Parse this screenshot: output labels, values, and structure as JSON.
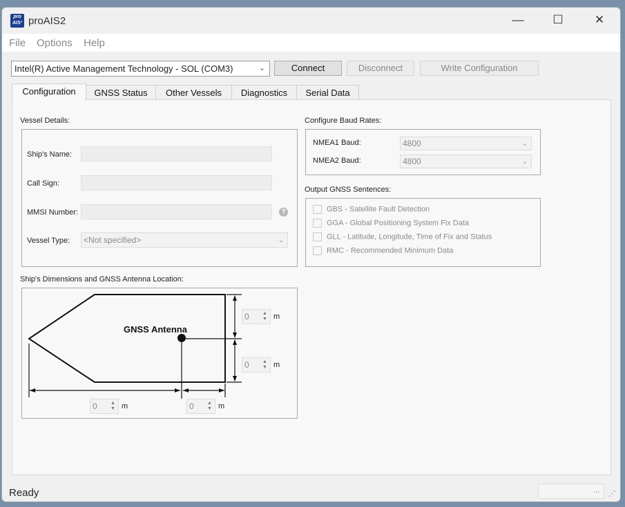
{
  "window": {
    "logo_text": "pro AIS²",
    "title": "proAIS2",
    "minimize": "—",
    "maximize": "☐",
    "close": "✕"
  },
  "menu": [
    "File",
    "Options",
    "Help"
  ],
  "toolbar": {
    "port": "Intel(R) Active Management Technology - SOL (COM3)",
    "connect": "Connect",
    "disconnect": "Disconnect",
    "write": "Write Configuration"
  },
  "tabs": [
    "Configuration",
    "GNSS Status",
    "Other Vessels",
    "Diagnostics",
    "Serial Data"
  ],
  "vessel": {
    "section_title": "Vessel Details:",
    "ship_name_label": "Ship's Name:",
    "ship_name_value": "",
    "call_sign_label": "Call Sign:",
    "call_sign_value": "",
    "mmsi_label": "MMSI Number:",
    "mmsi_value": "",
    "type_label": "Vessel Type:",
    "type_value": "<Not specified>",
    "help_icon": "?"
  },
  "baud": {
    "section_title": "Configure Baud Rates:",
    "nmea1_label": "NMEA1 Baud:",
    "nmea1_value": "4800",
    "nmea2_label": "NMEA2 Baud:",
    "nmea2_value": "4800"
  },
  "gnss": {
    "section_title": "Output GNSS Sentences:",
    "sentences": [
      {
        "label": "GBS - Satellite Fault Detection",
        "checked": false
      },
      {
        "label": "GGA - Global Positioning System Fix Data",
        "checked": false
      },
      {
        "label": "GLL - Latitude, Longitude, Time of Fix and Status",
        "checked": false
      },
      {
        "label": "RMC - Recommended Minimum Data",
        "checked": false
      }
    ]
  },
  "dimensions": {
    "section_title": "Ship's Dimensions and GNSS Antenna Location:",
    "antenna_label": "GNSS Antenna",
    "top_value": "0",
    "bottom_value": "0",
    "left_value": "0",
    "right_value": "0",
    "unit": "m"
  },
  "status": {
    "text": "Ready",
    "grip": "...",
    "resize": "⋰"
  }
}
